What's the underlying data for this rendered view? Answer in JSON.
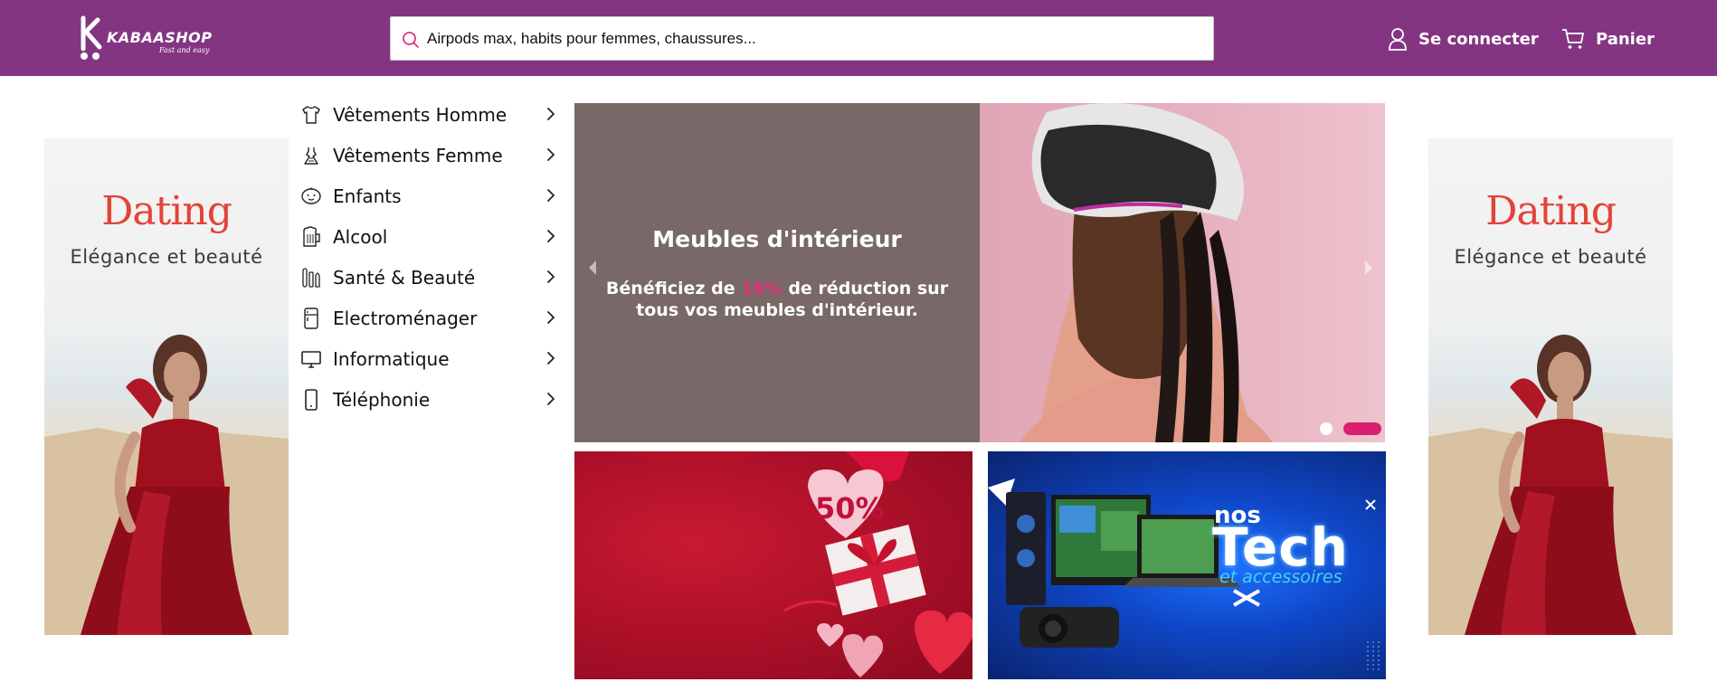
{
  "brand": {
    "name": "KABAASHOP",
    "tagline": "Fast and easy"
  },
  "search": {
    "placeholder": "Airpods max, habits pour femmes, chaussures..."
  },
  "header": {
    "login_label": "Se connecter",
    "cart_label": "Panier",
    "accent_color": "#843582"
  },
  "categories": [
    {
      "label": "Vêtements Homme",
      "icon": "tshirt-icon"
    },
    {
      "label": "Vêtements Femme",
      "icon": "dress-icon"
    },
    {
      "label": "Enfants",
      "icon": "baby-face-icon"
    },
    {
      "label": "Alcool",
      "icon": "beer-mug-icon"
    },
    {
      "label": "Santé & Beauté",
      "icon": "beauty-tools-icon"
    },
    {
      "label": "Electroménager",
      "icon": "fridge-icon"
    },
    {
      "label": "Informatique",
      "icon": "monitor-icon"
    },
    {
      "label": "Téléphonie",
      "icon": "phone-icon"
    }
  ],
  "hero": {
    "title": "Meubles d'intérieur",
    "desc_before": "Bénéficiez de ",
    "desc_highlight": "16%",
    "desc_after": " de réduction sur tous vos meubles d'intérieur.",
    "highlight_color": "#e0317a",
    "slides_count": 2,
    "active_slide": 2
  },
  "side_banner": {
    "title": "Dating",
    "subtitle": "Elégance et beauté"
  },
  "promos": {
    "valentine": {
      "badge": "50%"
    },
    "tech": {
      "line1": "nos",
      "line2": "Tech",
      "line3": "et accessoires"
    }
  }
}
